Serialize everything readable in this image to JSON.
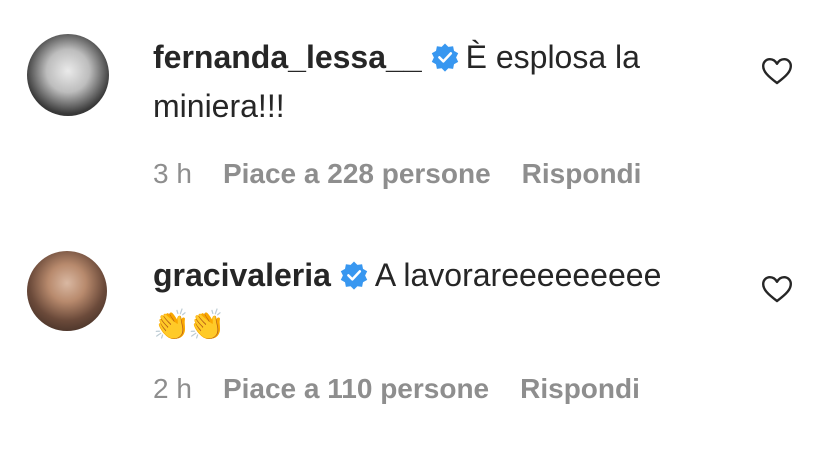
{
  "comments": [
    {
      "username": "fernanda_lessa__",
      "verified": true,
      "text": "È esplosa la miniera!!!",
      "emoji": "",
      "time": "3 h",
      "likes": "Piace a 228 persone",
      "reply": "Rispondi",
      "icons": {
        "verified": "verified-badge-icon",
        "like": "heart-outline-icon"
      }
    },
    {
      "username": "gracivaleria",
      "verified": true,
      "text": "A lavorareeeeeeeee",
      "emoji": "👏👏",
      "time": "2 h",
      "likes": "Piace a 110 persone",
      "reply": "Rispondi",
      "icons": {
        "verified": "verified-badge-icon",
        "like": "heart-outline-icon"
      }
    }
  ],
  "colors": {
    "text": "#262626",
    "meta": "#8e8e8e",
    "verified": "#3897f0"
  }
}
